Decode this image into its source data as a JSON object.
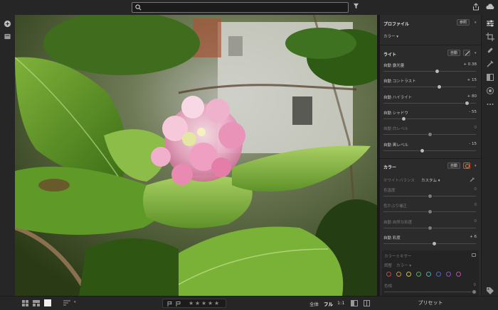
{
  "topbar": {
    "search_placeholder": ""
  },
  "panel": {
    "profile": {
      "title": "プロファイル",
      "button": "参照",
      "value": "カラー"
    },
    "light": {
      "title": "ライト",
      "auto_button": "自動",
      "rows": [
        {
          "label": "自動 露光量",
          "value": "+ 0.38",
          "pos": 0.58,
          "dim": false
        },
        {
          "label": "自動 コントラスト",
          "value": "+ 15",
          "pos": 0.6,
          "dim": false
        },
        {
          "label": "自動 ハイライト",
          "value": "+ 80",
          "pos": 0.9,
          "dim": false
        },
        {
          "label": "自動 シャドウ",
          "value": "- 55",
          "pos": 0.22,
          "dim": false
        },
        {
          "label": "自動 白レベル",
          "value": "0",
          "pos": 0.5,
          "dim": true
        },
        {
          "label": "自動 黒レベル",
          "value": "- 15",
          "pos": 0.42,
          "dim": false
        }
      ]
    },
    "color": {
      "title": "カラー",
      "auto_button": "自動",
      "wb_label": "ホワイトバランス",
      "wb_value": "カスタム",
      "rows": [
        {
          "label": "色温度",
          "value": "0",
          "pos": 0.5,
          "dim": true
        },
        {
          "label": "色かぶり補正",
          "value": "0",
          "pos": 0.5,
          "dim": true
        },
        {
          "label": "自動 自然な彩度",
          "value": "0",
          "pos": 0.5,
          "dim": true
        },
        {
          "label": "自動 彩度",
          "value": "+ 6",
          "pos": 0.55,
          "dim": false
        }
      ],
      "mixer": {
        "title": "カラーミキサー",
        "adjust_label": "調整",
        "adjust_value": "カラー",
        "dot_colors": [
          "#d04040",
          "#d88a30",
          "#d0c530",
          "#4fb04f",
          "#3fb3b3",
          "#4a63d6",
          "#8a4fd0",
          "#c04ab0"
        ],
        "hue_label": "色相",
        "hue_value": "0"
      }
    }
  },
  "bottombar": {
    "fit_all": "全体",
    "fit_full": "フル",
    "ratio": "1:1",
    "preset": "プリセット"
  }
}
